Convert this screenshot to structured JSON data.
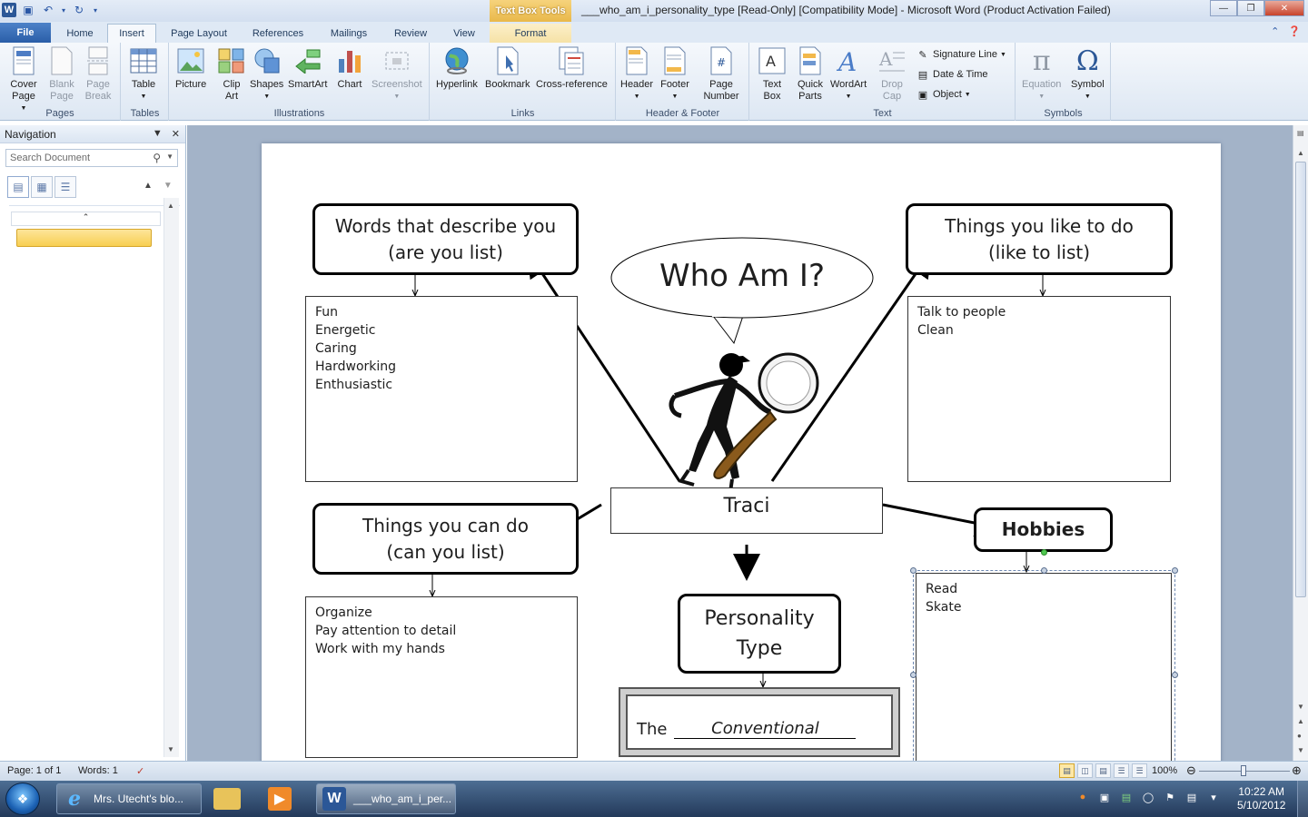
{
  "window": {
    "title": "___who_am_i_personality_type [Read-Only] [Compatibility Mode]  -  Microsoft Word (Product Activation Failed)",
    "context_tab_group": "Text Box Tools"
  },
  "tabs": [
    {
      "label": "File"
    },
    {
      "label": "Home"
    },
    {
      "label": "Insert"
    },
    {
      "label": "Page Layout"
    },
    {
      "label": "References"
    },
    {
      "label": "Mailings"
    },
    {
      "label": "Review"
    },
    {
      "label": "View"
    },
    {
      "label": "Format"
    }
  ],
  "ribbon": {
    "pages": {
      "label": "Pages",
      "cover": "Cover Page",
      "blank": "Blank Page",
      "break": "Page Break"
    },
    "tables": {
      "label": "Tables",
      "table": "Table"
    },
    "illustrations": {
      "label": "Illustrations",
      "picture": "Picture",
      "clipart": "Clip Art",
      "shapes": "Shapes",
      "smartart": "SmartArt",
      "chart": "Chart",
      "screenshot": "Screenshot"
    },
    "links": {
      "label": "Links",
      "hyperlink": "Hyperlink",
      "bookmark": "Bookmark",
      "crossref": "Cross-reference"
    },
    "header_footer": {
      "label": "Header & Footer",
      "header": "Header",
      "footer": "Footer",
      "pagenum": "Page Number"
    },
    "text": {
      "label": "Text",
      "textbox": "Text Box",
      "quickparts": "Quick Parts",
      "wordart": "WordArt",
      "dropcap": "Drop Cap",
      "sigline": "Signature Line",
      "datetime": "Date & Time",
      "object": "Object"
    },
    "symbols": {
      "label": "Symbols",
      "equation": "Equation",
      "symbol": "Symbol"
    }
  },
  "navigation": {
    "title": "Navigation",
    "search_placeholder": "Search Document"
  },
  "document": {
    "describe_heading_1": "Words that describe you",
    "describe_heading_2": "(are you list)",
    "describe_items": [
      "Fun",
      "Energetic",
      "Caring",
      "Hardworking",
      "Enthusiastic"
    ],
    "like_heading_1": "Things you like to do",
    "like_heading_2": "(like to list)",
    "like_items": [
      "Talk to people",
      "Clean"
    ],
    "bubble": "Who Am I?",
    "name": "Traci",
    "can_heading_1": "Things you can do",
    "can_heading_2": "(can you list)",
    "can_items": [
      "Organize",
      "Pay attention to detail",
      "Work with my hands"
    ],
    "hobbies_heading": "Hobbies",
    "hobbies_items": [
      "Read",
      "Skate"
    ],
    "personality_heading_1": "Personality",
    "personality_heading_2": "Type",
    "personality_prefix": "The",
    "personality_answer": "Conventional"
  },
  "status": {
    "page": "Page: 1 of 1",
    "words": "Words: 1",
    "zoom": "100%"
  },
  "taskbar": {
    "items": [
      {
        "label": "Mrs. Utecht's blo..."
      },
      {
        "label": "___who_am_i_per..."
      }
    ],
    "time": "10:22 AM",
    "date": "5/10/2012"
  }
}
